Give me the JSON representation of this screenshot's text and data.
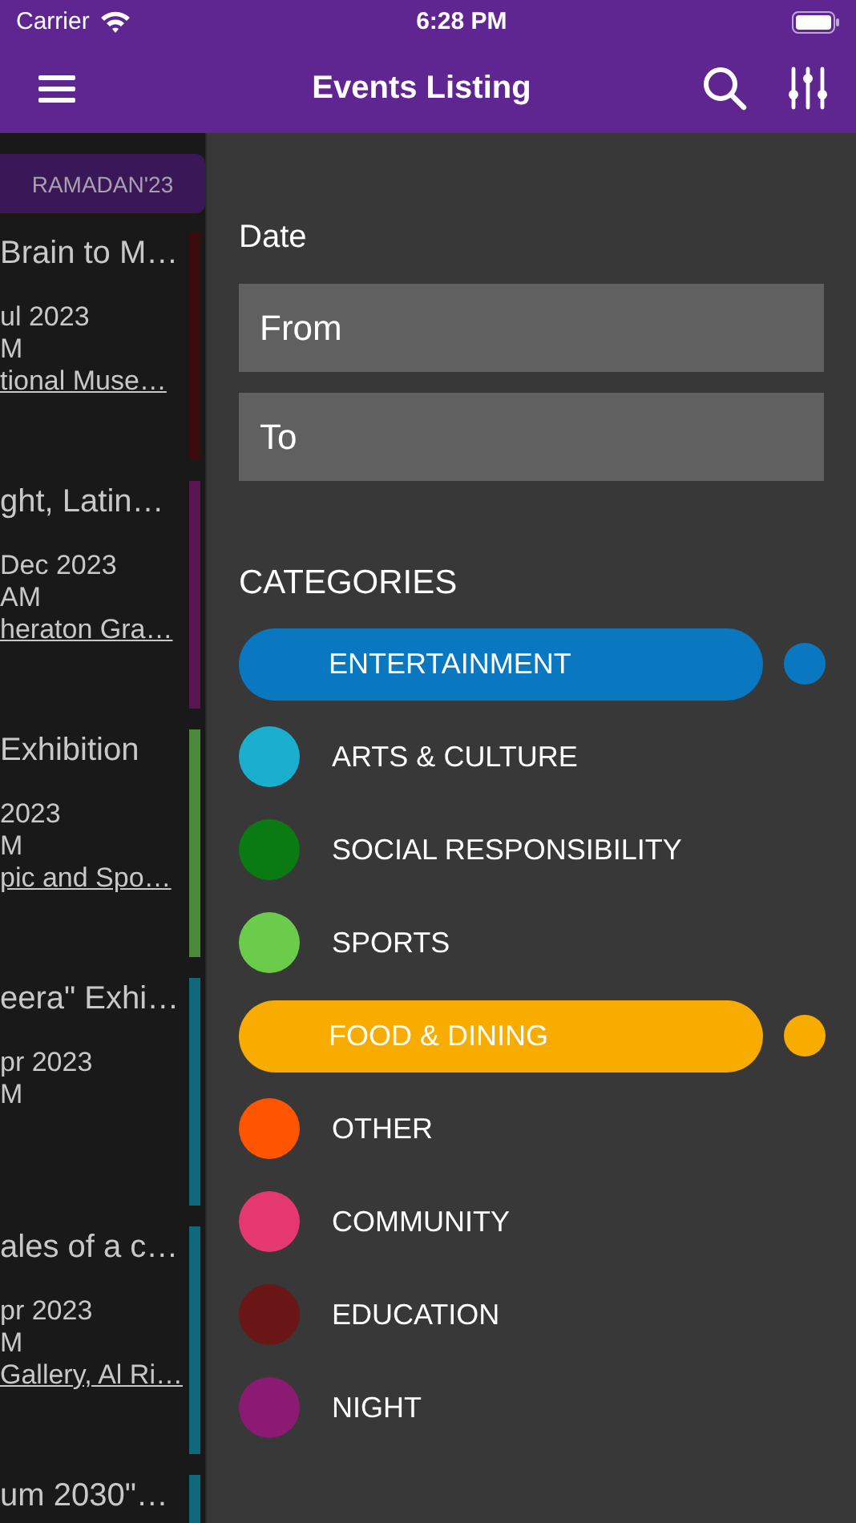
{
  "status_bar": {
    "carrier": "Carrier",
    "time": "6:28 PM"
  },
  "nav": {
    "title": "Events Listing"
  },
  "season_tab": {
    "label": "RAMADAN'23"
  },
  "events": [
    {
      "title": "Brain to M…",
      "date": "ul 2023",
      "time": "M",
      "venue": "tional Muse…",
      "color": "#3b0c0e"
    },
    {
      "title": "ght, Latin…",
      "date": "Dec 2023",
      "time": "AM",
      "venue": "heraton Gra…",
      "color": "#5a1550"
    },
    {
      "title": "Exhibition",
      "date": "2023",
      "time": "M",
      "venue": "pic and Spo…",
      "color": "#4b8a3b"
    },
    {
      "title": "eera\" Exhi…",
      "date": "pr 2023",
      "time": "M",
      "color": "#0e6a7a"
    },
    {
      "title": "ales of a c…",
      "date": "pr 2023",
      "time": "M",
      "venue": "Gallery, Al Ri…",
      "color": "#0e6a7a"
    },
    {
      "title": "um 2030\"…",
      "color": "#0e6a7a"
    }
  ],
  "filter": {
    "date_label": "Date",
    "from": {
      "placeholder": "From"
    },
    "to": {
      "placeholder": "To"
    },
    "categories_label": "CATEGORIES",
    "categories": [
      {
        "label": "ENTERTAINMENT",
        "color": "#0a78c0",
        "selected": true
      },
      {
        "label": "ARTS & CULTURE",
        "color": "#1aafcf",
        "selected": false
      },
      {
        "label": "SOCIAL RESPONSIBILITY",
        "color": "#0a7a12",
        "selected": false
      },
      {
        "label": "SPORTS",
        "color": "#6acc4a",
        "selected": false
      },
      {
        "label": "FOOD & DINING",
        "color": "#f8ac00",
        "selected": true
      },
      {
        "label": "OTHER",
        "color": "#ff5500",
        "selected": false
      },
      {
        "label": "COMMUNITY",
        "color": "#e63870",
        "selected": false
      },
      {
        "label": "EDUCATION",
        "color": "#6a1616",
        "selected": false
      },
      {
        "label": "NIGHT",
        "color": "#8a1a72",
        "selected": false
      }
    ]
  }
}
